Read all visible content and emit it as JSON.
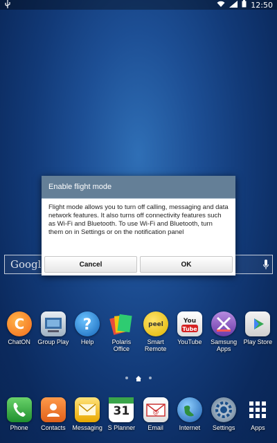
{
  "status_bar": {
    "usb_icon": "usb-icon",
    "time": "12:50",
    "icons": [
      "wifi-icon",
      "signal-icon",
      "battery-icon"
    ]
  },
  "search": {
    "logo": "Google"
  },
  "dialog": {
    "title": "Enable flight mode",
    "message": "Flight mode allows you to turn off calling, messaging and data network features. It also turns off connectivity features such as Wi-Fi and Bluetooth. To use Wi-Fi and Bluetooth, turn them on in Settings or on the notification panel",
    "cancel_label": "Cancel",
    "ok_label": "OK"
  },
  "apps": [
    {
      "label": "ChatON",
      "icon": "chaton-icon"
    },
    {
      "label": "Group Play",
      "icon": "group-play-icon"
    },
    {
      "label": "Help",
      "icon": "help-icon"
    },
    {
      "label": "Polaris Office",
      "icon": "polaris-office-icon"
    },
    {
      "label": "Smart Remote",
      "icon": "smart-remote-icon"
    },
    {
      "label": "YouTube",
      "icon": "youtube-icon"
    },
    {
      "label": "Samsung Apps",
      "icon": "samsung-apps-icon"
    },
    {
      "label": "Play Store",
      "icon": "play-store-icon"
    }
  ],
  "dock": [
    {
      "label": "Phone",
      "icon": "phone-icon"
    },
    {
      "label": "Contacts",
      "icon": "contacts-icon"
    },
    {
      "label": "Messaging",
      "icon": "messaging-icon"
    },
    {
      "label": "S Planner",
      "icon": "calendar-icon",
      "day": "31"
    },
    {
      "label": "Email",
      "icon": "email-icon"
    },
    {
      "label": "Internet",
      "icon": "internet-icon"
    },
    {
      "label": "Settings",
      "icon": "settings-icon"
    },
    {
      "label": "Apps",
      "icon": "apps-grid-icon"
    }
  ],
  "colors": {
    "dialog_header": "#647f97",
    "wallpaper": "#123a78"
  }
}
